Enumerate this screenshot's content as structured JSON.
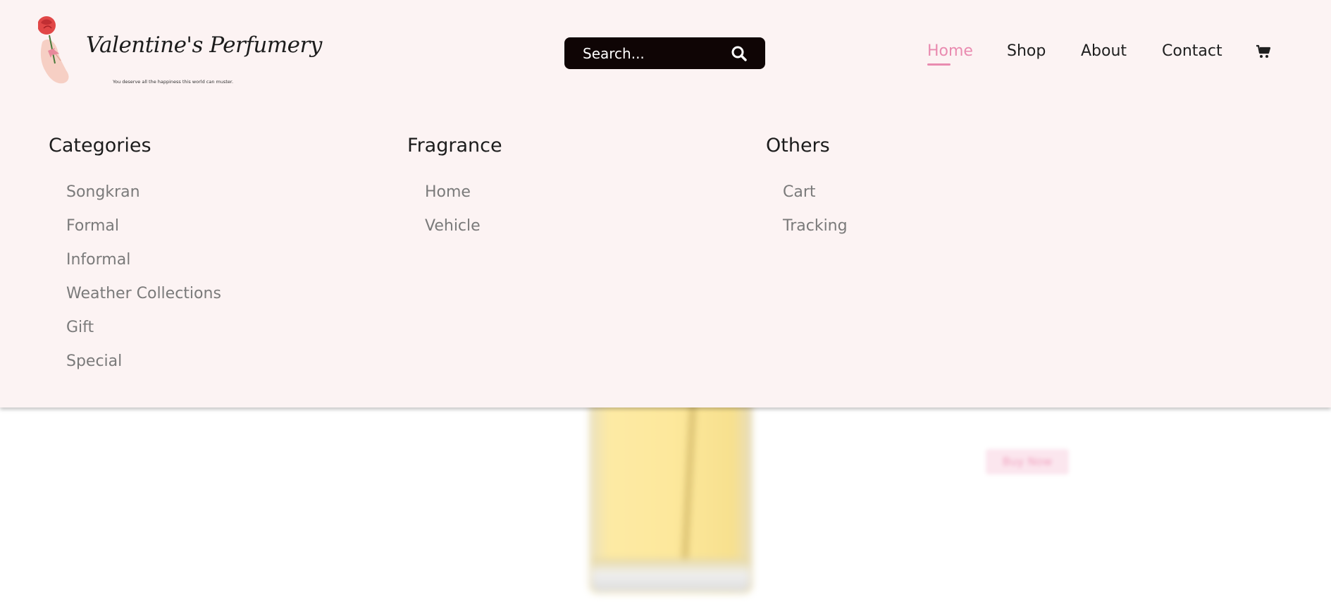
{
  "brand": {
    "name": "Valentine's Perfumery",
    "tagline": "You deserve all the happiness this world can muster."
  },
  "search": {
    "placeholder": "Search...",
    "icon": "search-icon"
  },
  "nav": {
    "items": [
      {
        "label": "Home",
        "active": true
      },
      {
        "label": "Shop",
        "active": false
      },
      {
        "label": "About",
        "active": false
      },
      {
        "label": "Contact",
        "active": false
      }
    ],
    "cart_icon": "shopping-cart-icon",
    "active_color": "#e98bb0"
  },
  "menu": {
    "columns": [
      {
        "title": "Categories",
        "items": [
          "Songkran",
          "Formal",
          "Informal",
          "Weather Collections",
          "Gift",
          "Special"
        ]
      },
      {
        "title": "Fragrance",
        "items": [
          "Home",
          "Vehicle"
        ]
      },
      {
        "title": "Others",
        "items": [
          "Cart",
          "Tracking"
        ]
      }
    ]
  },
  "background": {
    "cta_label": "Buy Now"
  },
  "colors": {
    "header_bg": "#fcf3f3",
    "search_bg": "#0f0505",
    "accent_pink": "#e98bb0"
  }
}
